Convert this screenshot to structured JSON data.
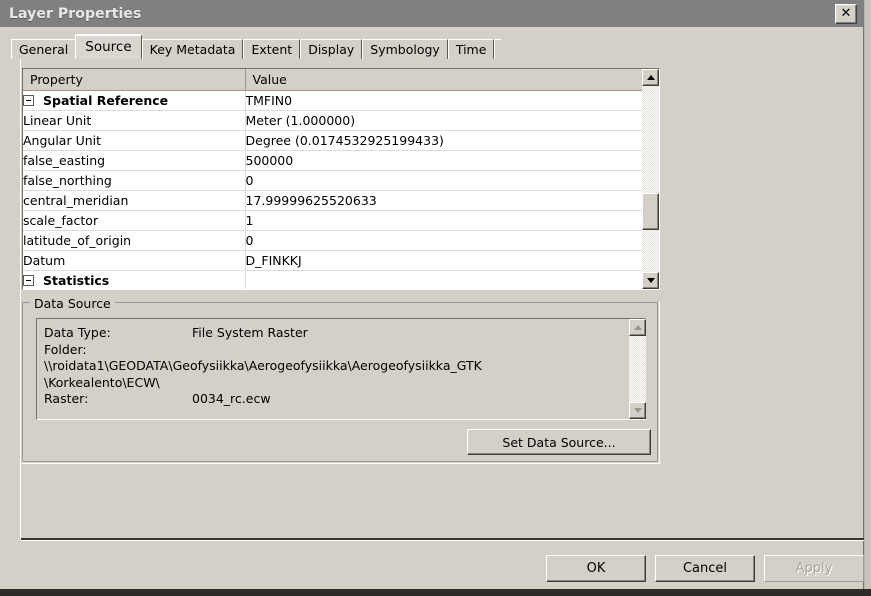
{
  "window": {
    "title": "Layer Properties",
    "close_label": "✕",
    "close_icon": "close-icon"
  },
  "tabs": [
    {
      "label": "General",
      "selected": false
    },
    {
      "label": "Source",
      "selected": true
    },
    {
      "label": "Key Metadata",
      "selected": false
    },
    {
      "label": "Extent",
      "selected": false
    },
    {
      "label": "Display",
      "selected": false
    },
    {
      "label": "Symbology",
      "selected": false
    },
    {
      "label": "Time",
      "selected": false
    }
  ],
  "property_grid": {
    "columns": [
      "Property",
      "Value"
    ],
    "rows": [
      {
        "property": "Spatial Reference",
        "value": "TMFIN0",
        "type": "group",
        "expander": "minus-box-icon"
      },
      {
        "property": "Linear Unit",
        "value": "Meter (1.000000)",
        "type": "child"
      },
      {
        "property": "Angular Unit",
        "value": "Degree (0.0174532925199433)",
        "type": "child"
      },
      {
        "property": "false_easting",
        "value": "500000",
        "type": "child"
      },
      {
        "property": "false_northing",
        "value": "0",
        "type": "child"
      },
      {
        "property": "central_meridian",
        "value": "17.99999625520633",
        "type": "child"
      },
      {
        "property": "scale_factor",
        "value": "1",
        "type": "child"
      },
      {
        "property": "latitude_of_origin",
        "value": "0",
        "type": "child"
      },
      {
        "property": "Datum",
        "value": "D_FINKKJ",
        "type": "child"
      },
      {
        "property": "Statistics",
        "value": "",
        "type": "group",
        "expander": "minus-box-icon"
      }
    ],
    "scrollbar": {
      "up_icon": "scroll-up-arrow-icon",
      "down_icon": "scroll-down-arrow-icon",
      "thumb_name": "scroll-thumb"
    }
  },
  "data_source": {
    "legend": "Data Source",
    "fields": [
      {
        "label": "Data Type:",
        "value": "File System Raster"
      },
      {
        "label": "Folder:",
        "value": "\\\\roidata1\\GEODATA\\Geofysiikka\\Aerogeofysiikka\\Aerogeofysiikka_GTK",
        "continuation": "\\Korkealento\\ECW\\"
      },
      {
        "label": "Raster:",
        "value": "0034_rc.ecw"
      }
    ],
    "scrollbar": {
      "up_icon": "scroll-up-arrow-icon",
      "down_icon": "scroll-down-arrow-icon",
      "enabled": false
    },
    "set_button": "Set Data Source..."
  },
  "footer": {
    "ok": "OK",
    "cancel": "Cancel",
    "apply": "Apply",
    "apply_enabled": false
  },
  "colors": {
    "dialog_face": "#d4d0c8",
    "titlebar": "#808080",
    "titlebar_text": "#e8e8e8",
    "grid_background": "#ffffff",
    "grid_line": "#dcdcdc",
    "header_face": "#d4d0c8",
    "disabled_text": "#a7a39b"
  }
}
